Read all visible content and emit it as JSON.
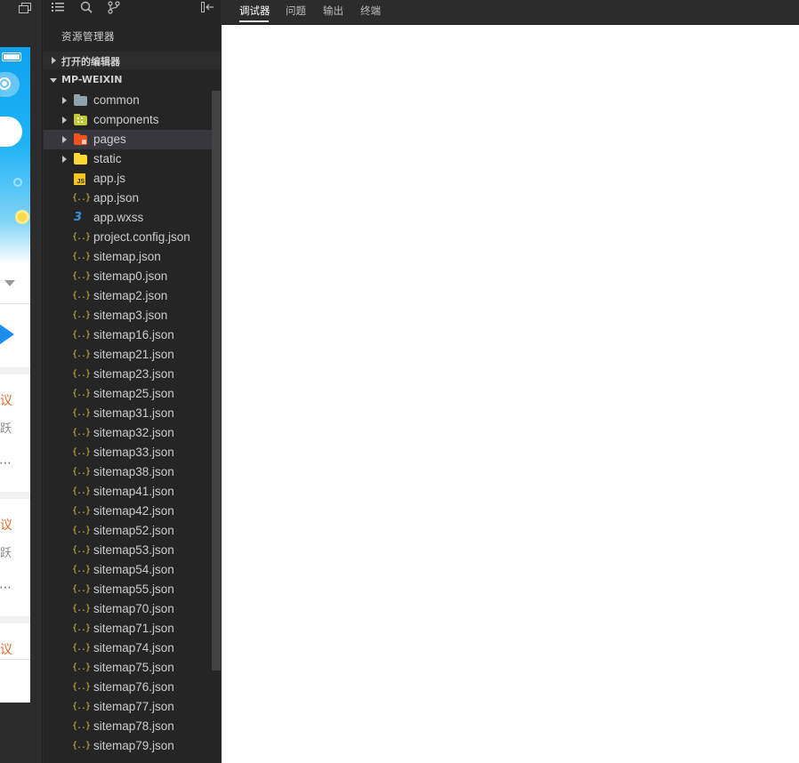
{
  "simulator": {
    "window_icon": "restore-window-icon",
    "phone": {
      "partial_texts": [
        "议",
        "跃",
        "⋯",
        "议",
        "跃",
        "⋯",
        "议"
      ],
      "colors": {
        "banner": "#1eb2f5",
        "accent_text": "#e06b2a",
        "arrow": "#1d8ef0"
      }
    }
  },
  "explorer": {
    "toolbar_icons": [
      "list-icon",
      "search-icon",
      "source-control-icon",
      "collapse-panel-icon"
    ],
    "title": "资源管理器",
    "sections": [
      {
        "label": "打开的编辑器",
        "expanded": false
      },
      {
        "label": "MP-WEIXIN",
        "expanded": true
      }
    ],
    "folders": [
      {
        "name": "common",
        "icon": "folder-icon",
        "color": "#90a4ae"
      },
      {
        "name": "components",
        "icon": "components-folder-icon",
        "color": "#c0ca33"
      },
      {
        "name": "pages",
        "icon": "pages-folder-icon",
        "color": "#f4511e",
        "selected": true
      },
      {
        "name": "static",
        "icon": "folder-icon",
        "color": "#fdd835"
      }
    ],
    "files": [
      {
        "name": "app.js",
        "icon": "js-file-icon",
        "glyph": "JS"
      },
      {
        "name": "app.json",
        "icon": "json-file-icon",
        "glyph": "{..}"
      },
      {
        "name": "app.wxss",
        "icon": "css-file-icon",
        "glyph": "3"
      },
      {
        "name": "project.config.json",
        "icon": "json-file-icon",
        "glyph": "{..}"
      },
      {
        "name": "sitemap.json",
        "icon": "json-file-icon",
        "glyph": "{..}"
      },
      {
        "name": "sitemap0.json",
        "icon": "json-file-icon",
        "glyph": "{..}"
      },
      {
        "name": "sitemap2.json",
        "icon": "json-file-icon",
        "glyph": "{..}"
      },
      {
        "name": "sitemap3.json",
        "icon": "json-file-icon",
        "glyph": "{..}"
      },
      {
        "name": "sitemap16.json",
        "icon": "json-file-icon",
        "glyph": "{..}"
      },
      {
        "name": "sitemap21.json",
        "icon": "json-file-icon",
        "glyph": "{..}"
      },
      {
        "name": "sitemap23.json",
        "icon": "json-file-icon",
        "glyph": "{..}"
      },
      {
        "name": "sitemap25.json",
        "icon": "json-file-icon",
        "glyph": "{..}"
      },
      {
        "name": "sitemap31.json",
        "icon": "json-file-icon",
        "glyph": "{..}"
      },
      {
        "name": "sitemap32.json",
        "icon": "json-file-icon",
        "glyph": "{..}"
      },
      {
        "name": "sitemap33.json",
        "icon": "json-file-icon",
        "glyph": "{..}"
      },
      {
        "name": "sitemap38.json",
        "icon": "json-file-icon",
        "glyph": "{..}"
      },
      {
        "name": "sitemap41.json",
        "icon": "json-file-icon",
        "glyph": "{..}"
      },
      {
        "name": "sitemap42.json",
        "icon": "json-file-icon",
        "glyph": "{..}"
      },
      {
        "name": "sitemap52.json",
        "icon": "json-file-icon",
        "glyph": "{..}"
      },
      {
        "name": "sitemap53.json",
        "icon": "json-file-icon",
        "glyph": "{..}"
      },
      {
        "name": "sitemap54.json",
        "icon": "json-file-icon",
        "glyph": "{..}"
      },
      {
        "name": "sitemap55.json",
        "icon": "json-file-icon",
        "glyph": "{..}"
      },
      {
        "name": "sitemap70.json",
        "icon": "json-file-icon",
        "glyph": "{..}"
      },
      {
        "name": "sitemap71.json",
        "icon": "json-file-icon",
        "glyph": "{..}"
      },
      {
        "name": "sitemap74.json",
        "icon": "json-file-icon",
        "glyph": "{..}"
      },
      {
        "name": "sitemap75.json",
        "icon": "json-file-icon",
        "glyph": "{..}"
      },
      {
        "name": "sitemap76.json",
        "icon": "json-file-icon",
        "glyph": "{..}"
      },
      {
        "name": "sitemap77.json",
        "icon": "json-file-icon",
        "glyph": "{..}"
      },
      {
        "name": "sitemap78.json",
        "icon": "json-file-icon",
        "glyph": "{..}"
      },
      {
        "name": "sitemap79.json",
        "icon": "json-file-icon",
        "glyph": "{..}"
      }
    ],
    "colors": {
      "background": "#252526",
      "selected_row": "#37373d",
      "text": "#cccccc",
      "json_icon": "#e3b83a",
      "css_icon": "#3f8fd8",
      "js_icon": "#f5c518"
    }
  },
  "debug_panel": {
    "tabs": [
      {
        "label": "调试器",
        "active": true
      },
      {
        "label": "问题",
        "active": false
      },
      {
        "label": "输出",
        "active": false
      },
      {
        "label": "终端",
        "active": false
      }
    ],
    "colors": {
      "tab_bar": "#2c2c2c",
      "content": "#ffffff"
    }
  }
}
